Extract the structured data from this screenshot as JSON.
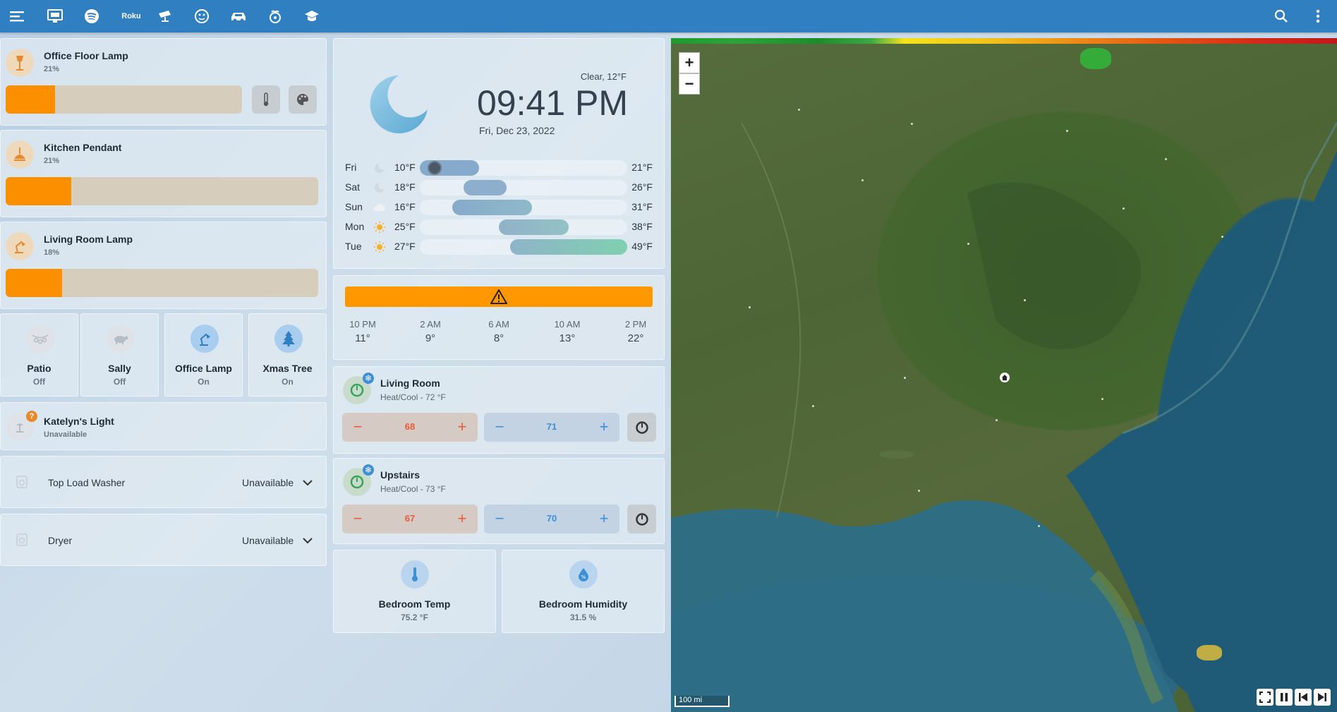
{
  "topbar": {
    "icons": [
      "menu-icon",
      "monitor-icon",
      "spotify-icon",
      "roku-icon",
      "security-camera-icon",
      "robot-vacuum-icon",
      "car-icon",
      "raspberry-pi-icon",
      "graduation-icon"
    ],
    "roku_label": "Roku",
    "color": "#2f7fc1"
  },
  "lights": [
    {
      "name": "Office Floor Lamp",
      "brightness": "21%",
      "level": 0.21
    },
    {
      "name": "Kitchen Pendant",
      "brightness": "21%",
      "level": 0.21
    },
    {
      "name": "Living Room Lamp",
      "brightness": "18%",
      "level": 0.18
    }
  ],
  "tiles": [
    {
      "name": "Patio",
      "state": "Off"
    },
    {
      "name": "Sally",
      "state": "Off"
    },
    {
      "name": "Office Lamp",
      "state": "On"
    },
    {
      "name": "Xmas Tree",
      "state": "On"
    }
  ],
  "katelyn": {
    "name": "Katelyn's Light",
    "state": "Unavailable",
    "badge": "?"
  },
  "appliances": [
    {
      "name": "Top Load Washer",
      "state": "Unavailable"
    },
    {
      "name": "Dryer",
      "state": "Unavailable"
    }
  ],
  "weather": {
    "condition": "Clear, 12°F",
    "time": "09:41 PM",
    "date": "Fri, Dec 23, 2022",
    "forecast": [
      {
        "day": "Fri",
        "icon": "moon-icon",
        "lo": "10°F",
        "hi": "21°F"
      },
      {
        "day": "Sat",
        "icon": "moon-icon",
        "lo": "18°F",
        "hi": "26°F"
      },
      {
        "day": "Sun",
        "icon": "cloud-icon",
        "lo": "16°F",
        "hi": "31°F"
      },
      {
        "day": "Mon",
        "icon": "sun-icon",
        "lo": "25°F",
        "hi": "38°F"
      },
      {
        "day": "Tue",
        "icon": "sun-icon",
        "lo": "27°F",
        "hi": "49°F"
      }
    ]
  },
  "hourly": [
    {
      "time": "10 PM",
      "temp": "11°"
    },
    {
      "time": "2 AM",
      "temp": "9°"
    },
    {
      "time": "6 AM",
      "temp": "8°"
    },
    {
      "time": "10 AM",
      "temp": "13°"
    },
    {
      "time": "2 PM",
      "temp": "22°"
    }
  ],
  "climate": [
    {
      "name": "Living Room",
      "mode": "Heat/Cool - 72 °F",
      "heat": "68",
      "cool": "71"
    },
    {
      "name": "Upstairs",
      "mode": "Heat/Cool - 73 °F",
      "heat": "67",
      "cool": "70"
    }
  ],
  "sensors": [
    {
      "name": "Bedroom Temp",
      "value": "75.2 °F",
      "icon": "thermometer-icon"
    },
    {
      "name": "Bedroom Humidity",
      "value": "31.5 %",
      "icon": "water-drop-icon"
    }
  ],
  "map": {
    "zoom_in": "+",
    "zoom_out": "−",
    "scale": "100 mi",
    "controls": [
      "fullscreen-icon",
      "pause-icon",
      "skip-back-icon",
      "skip-forward-icon"
    ]
  },
  "colors": {
    "accent": "#2f7fc1",
    "light_fill": "#fb8f00",
    "heat": "#e55b3c",
    "cool": "#3d8fd6",
    "warning": "#ff9800"
  }
}
